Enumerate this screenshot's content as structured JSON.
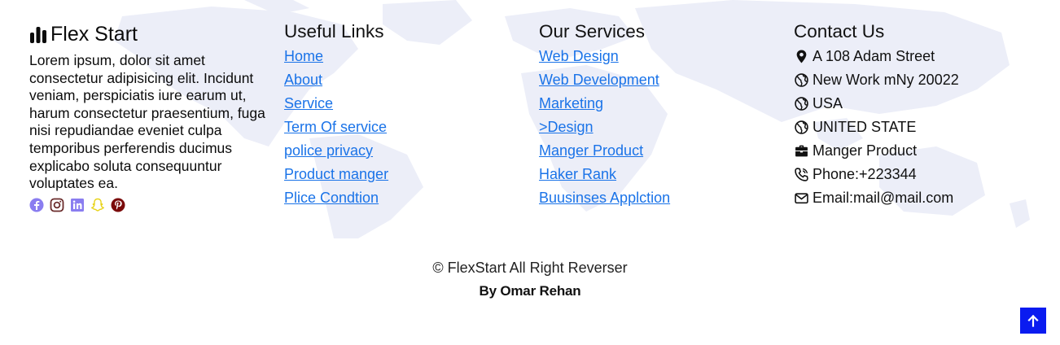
{
  "brand": {
    "name": "Flex Start",
    "icon": "bar-chart-icon",
    "description": "Lorem ipsum, dolor sit amet consectetur adipisicing elit. Incidunt veniam, perspiciatis iure earum ut, harum consectetur praesentium, fuga nisi repudiandae eveniet culpa temporibus perferendis ducimus explicabo soluta consequuntur voluptates ea."
  },
  "social": [
    {
      "icon": "facebook-icon",
      "color": "#8a7df0"
    },
    {
      "icon": "instagram-icon",
      "color": "#6b2d2d"
    },
    {
      "icon": "linkedin-icon",
      "color": "#8a7df0"
    },
    {
      "icon": "snapchat-icon",
      "color": "#e8d31a"
    },
    {
      "icon": "pinterest-icon",
      "color": "#7a0a0a"
    }
  ],
  "useful_links": {
    "title": "Useful Links",
    "items": [
      "Home",
      "About",
      "Service",
      "Term Of service",
      "police privacy",
      "Product manger",
      "Plice Condtion"
    ]
  },
  "services": {
    "title": "Our Services",
    "items": [
      "Web Design",
      "Web Development",
      "Marketing",
      ">Design",
      "Manger Product",
      "Haker Rank",
      "Buusinses Applction"
    ]
  },
  "contact": {
    "title": "Contact Us",
    "items": [
      {
        "icon": "map-pin-icon",
        "text": "A 108 Adam Street"
      },
      {
        "icon": "globe-icon",
        "text": "New Work mNy 20022"
      },
      {
        "icon": "globe-icon",
        "text": "USA"
      },
      {
        "icon": "globe-icon",
        "text": "UNITED STATE"
      },
      {
        "icon": "briefcase-icon",
        "text": "Manger Product"
      },
      {
        "icon": "phone-icon",
        "text": "Phone:+223344"
      },
      {
        "icon": "envelope-icon",
        "text": "Email:mail@mail.com"
      }
    ]
  },
  "footer": {
    "copyright": "© FlexStart All Right Reverser",
    "author": "By Omar Rehan"
  },
  "colors": {
    "link": "#1a73e8",
    "map": "#eceef8",
    "back_to_top": "#0a1bf0"
  }
}
